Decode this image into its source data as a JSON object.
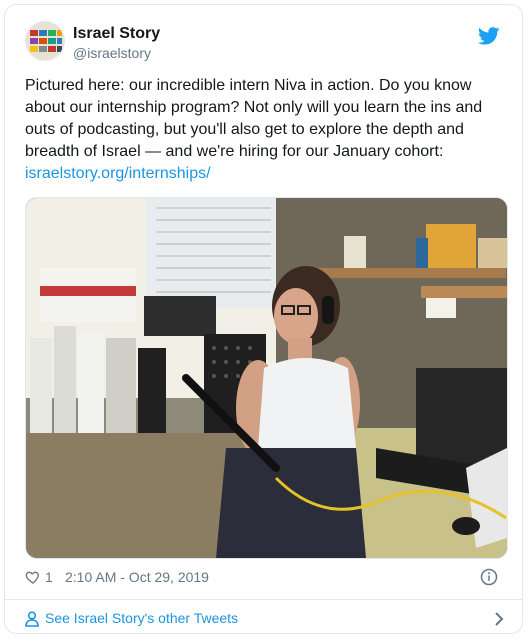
{
  "account": {
    "display_name": "Israel Story",
    "handle": "@israelstory"
  },
  "tweet": {
    "text": "Pictured here: our incredible intern Niva in action. Do you know about our internship program? Not only will you learn the ins and outs of podcasting, but you'll also get to explore the depth and breadth of Israel — and we're hiring for our January cohort: ",
    "link": "israelstory.org/internships/"
  },
  "meta": {
    "like_count": "1",
    "timestamp": "2:10 AM - Oct 29, 2019"
  },
  "footer": {
    "link_text": "See Israel Story's other Tweets"
  },
  "icons": {
    "brand": "twitter-bird-icon",
    "like": "heart-icon",
    "info": "info-icon",
    "person": "person-icon",
    "chevron": "chevron-right-icon"
  },
  "colors": {
    "link": "#1b95e0",
    "muted": "#657786",
    "text": "#14171a",
    "border": "#e1e8ed"
  }
}
